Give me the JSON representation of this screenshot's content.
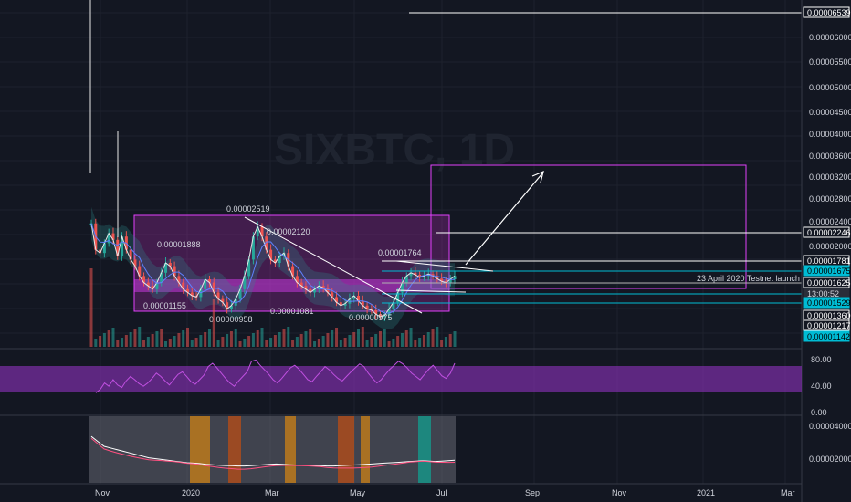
{
  "chart_data": {
    "type": "candlestick",
    "symbol": "SIXBTC, 1D",
    "x_axis_labels": [
      "Nov",
      "2020",
      "Mar",
      "May",
      "Jul",
      "Sep",
      "Nov",
      "2021",
      "Mar"
    ],
    "price_axis_ticks": [
      "0.00006000",
      "0.00005500",
      "0.00005000",
      "0.00004500",
      "0.00004000",
      "0.00003600",
      "0.00003200",
      "0.00002800",
      "0.00002400",
      "0.00002000"
    ],
    "price_tags": [
      {
        "label": "0.00006539",
        "style": "outline",
        "color": "#ffffff"
      },
      {
        "label": "0.00002246",
        "style": "outline",
        "color": "#ffffff"
      },
      {
        "label": "0.00001781",
        "style": "outline",
        "color": "#ffffff"
      },
      {
        "label": "0.00001675",
        "style": "fill",
        "color": "#00bcd4"
      },
      {
        "label": "0.00001625",
        "style": "outline",
        "color": "#ffffff"
      },
      {
        "label": "13:00:52",
        "style": "fill-dark",
        "color": "#2a2e39"
      },
      {
        "label": "0.00001529",
        "style": "fill",
        "color": "#00bcd4"
      },
      {
        "label": "0.00001360",
        "style": "outline",
        "color": "#ffffff"
      },
      {
        "label": "0.00001217",
        "style": "outline",
        "color": "#ffffff"
      },
      {
        "label": "0.00001142",
        "style": "fill",
        "color": "#00bcd4"
      }
    ],
    "annotations": [
      {
        "label": "0.00002519"
      },
      {
        "label": "0.00002120"
      },
      {
        "label": "0.00001888"
      },
      {
        "label": "0.00001764"
      },
      {
        "label": "0.00001155"
      },
      {
        "label": "0.00000958"
      },
      {
        "label": "0.00001081"
      },
      {
        "label": "0.00000975"
      },
      {
        "label": "23 April 2020 Testnet launch"
      }
    ],
    "close_series": [
      2.5,
      2.1,
      2.05,
      2.2,
      2.35,
      2.25,
      2.0,
      2.3,
      2.1,
      1.95,
      1.85,
      1.7,
      1.6,
      1.55,
      1.5,
      1.6,
      1.75,
      1.9,
      1.85,
      1.7,
      1.6,
      1.5,
      1.45,
      1.4,
      1.38,
      1.5,
      1.65,
      1.6,
      1.45,
      1.35,
      1.3,
      1.2,
      1.25,
      1.35,
      1.5,
      1.7,
      1.95,
      2.3,
      2.45,
      2.3,
      2.1,
      1.95,
      1.9,
      2.0,
      2.05,
      1.85,
      1.7,
      1.6,
      1.55,
      1.5,
      1.45,
      1.5,
      1.55,
      1.52,
      1.45,
      1.38,
      1.3,
      1.25,
      1.28,
      1.35,
      1.4,
      1.32,
      1.25,
      1.2,
      1.18,
      1.12,
      1.08,
      1.1,
      1.2,
      1.3,
      1.45,
      1.6,
      1.7,
      1.75,
      1.72,
      1.68,
      1.7,
      1.73,
      1.7,
      1.66,
      1.62,
      1.6,
      1.65,
      1.7
    ],
    "rsi": {
      "ticks": [
        "80.00",
        "40.00",
        "0.00"
      ],
      "values": [
        30,
        35,
        45,
        40,
        50,
        42,
        38,
        48,
        55,
        50,
        44,
        40,
        45,
        52,
        60,
        55,
        48,
        42,
        50,
        58,
        62,
        55,
        47,
        43,
        50,
        57,
        70,
        75,
        68,
        60,
        52,
        45,
        40,
        48,
        55,
        62,
        78,
        80,
        72,
        65,
        58,
        50,
        45,
        52,
        60,
        68,
        72,
        66,
        58,
        50,
        47,
        55,
        62,
        70,
        65,
        58,
        52,
        48,
        55,
        62,
        68,
        74,
        70,
        60,
        52,
        45,
        50,
        58,
        66,
        72,
        78,
        74,
        68,
        60,
        55,
        50,
        58,
        66,
        72,
        64,
        56,
        52,
        60,
        75
      ]
    },
    "lower_indicator": {
      "ticks": [
        "0.00004000",
        "0.00002000"
      ],
      "values": [
        2.6,
        2.3,
        2.0,
        1.9,
        1.8,
        1.7,
        1.6,
        1.5,
        1.4,
        1.3,
        1.25,
        1.2,
        1.15,
        1.1,
        1.05,
        1.0,
        0.98,
        0.95,
        0.9,
        0.88,
        0.85,
        0.83,
        0.82,
        0.8,
        0.8,
        0.82,
        0.85,
        0.88,
        0.9,
        0.92,
        0.9,
        0.88,
        0.86,
        0.85,
        0.84,
        0.83,
        0.82,
        0.8,
        0.8,
        0.82,
        0.84,
        0.86,
        0.88,
        0.9,
        0.92,
        0.95,
        0.98,
        1.0,
        1.02,
        1.05,
        1.08,
        1.1,
        1.12,
        1.1,
        1.08,
        1.1,
        1.12,
        1.15
      ]
    }
  }
}
